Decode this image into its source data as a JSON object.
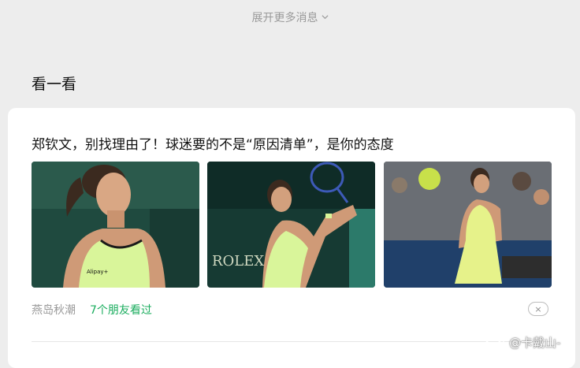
{
  "expand": {
    "label": "展开更多消息"
  },
  "section": {
    "title": "看一看"
  },
  "article": {
    "title": "郑钦文，别找理由了！球迷要的不是“原因清单”，是你的态度",
    "images": [
      {
        "subject": "tennis-player-closeup",
        "sponsor_text": "Alipay+"
      },
      {
        "subject": "tennis-player-forehand",
        "sponsor_text": "ROLEX"
      },
      {
        "subject": "tennis-player-on-court",
        "sponsor_text": ""
      }
    ],
    "source": "燕岛秋潮",
    "friends_viewed": "7个朋友看过",
    "close_icon": "×"
  },
  "watermark": {
    "text": "@卡戴山-"
  },
  "colors": {
    "background": "#ededed",
    "card": "#ffffff",
    "accent_green": "#1aad5e",
    "muted": "#9a9a9a"
  }
}
